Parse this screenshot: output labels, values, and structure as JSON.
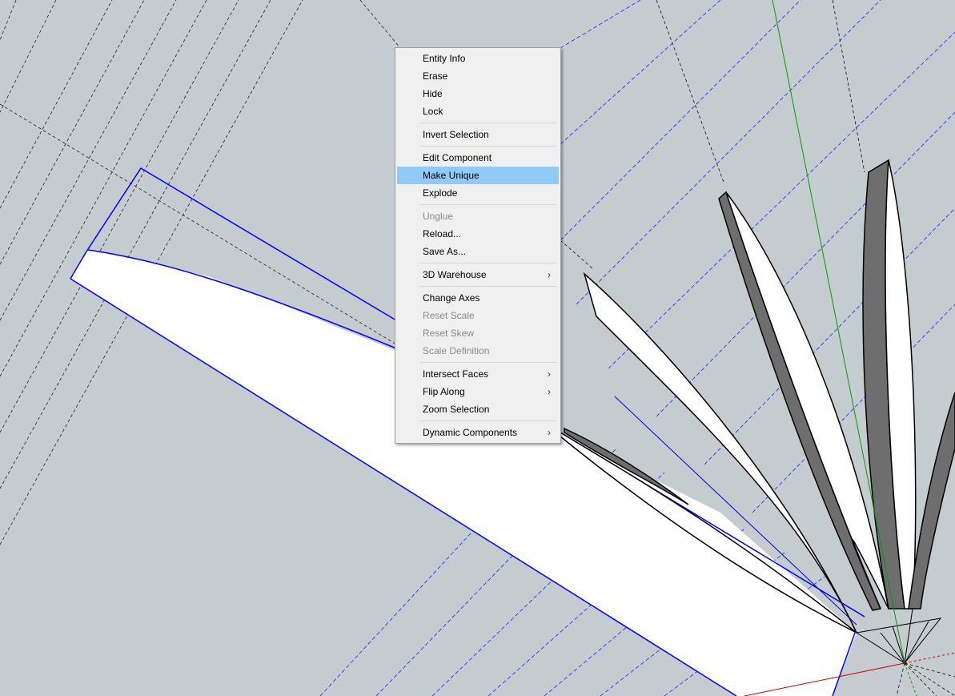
{
  "menu": {
    "groups": [
      [
        {
          "label": "Entity Info",
          "enabled": true
        },
        {
          "label": "Erase",
          "enabled": true
        },
        {
          "label": "Hide",
          "enabled": true
        },
        {
          "label": "Lock",
          "enabled": true
        }
      ],
      [
        {
          "label": "Invert Selection",
          "enabled": true
        }
      ],
      [
        {
          "label": "Edit Component",
          "enabled": true
        },
        {
          "label": "Make Unique",
          "enabled": true,
          "highlighted": true
        },
        {
          "label": "Explode",
          "enabled": true
        }
      ],
      [
        {
          "label": "Unglue",
          "enabled": false
        },
        {
          "label": "Reload...",
          "enabled": true
        },
        {
          "label": "Save As...",
          "enabled": true
        }
      ],
      [
        {
          "label": "3D Warehouse",
          "enabled": true,
          "submenu": true
        }
      ],
      [
        {
          "label": "Change Axes",
          "enabled": true
        },
        {
          "label": "Reset Scale",
          "enabled": false
        },
        {
          "label": "Reset Skew",
          "enabled": false
        },
        {
          "label": "Scale Definition",
          "enabled": false
        }
      ],
      [
        {
          "label": "Intersect Faces",
          "enabled": true,
          "submenu": true
        },
        {
          "label": "Flip Along",
          "enabled": true,
          "submenu": true
        },
        {
          "label": "Zoom Selection",
          "enabled": true
        }
      ],
      [
        {
          "label": "Dynamic Components",
          "enabled": true,
          "submenu": true
        }
      ]
    ],
    "submenu_glyph": "›"
  },
  "colors": {
    "background": "#c5ccd0",
    "selection_blue": "#0000ff",
    "face_white": "#ffffff",
    "face_dark": "#6e6e6e",
    "highlight": "#91c9f7",
    "green_axis": "#00a000",
    "red_axis": "#d00000"
  }
}
